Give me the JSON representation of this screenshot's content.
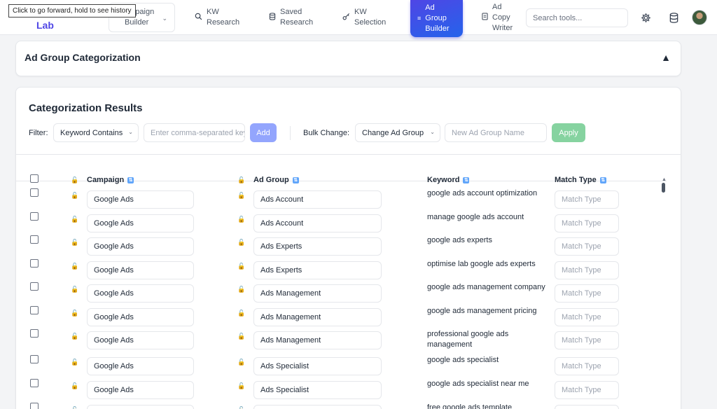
{
  "app": {
    "brand_fragment": "Lab",
    "tooltip": "Click to go forward, hold to see history"
  },
  "nav": {
    "campaign_builder": [
      "ampaign",
      "Builder"
    ],
    "kw_research": [
      "KW",
      "Research"
    ],
    "saved_research": [
      "Saved",
      "Research"
    ],
    "kw_selection": [
      "KW",
      "Selection"
    ],
    "ad_group_builder": [
      "Ad",
      "Group",
      "Builder"
    ],
    "ad_copy_writer": [
      "Ad",
      "Copy",
      "Writer"
    ],
    "search_placeholder": "Search tools...",
    "active_item": "ad_group_builder",
    "active_gradient": [
      "#4f46e5",
      "#2563eb"
    ]
  },
  "section": {
    "title": "Ad Group Categorization",
    "collapse_glyph": "▲"
  },
  "results": {
    "title": "Categorization Results",
    "filter": {
      "label": "Filter:",
      "select_value": "Keyword Contains",
      "input_placeholder": "Enter comma-separated keywords",
      "add_label": "Add"
    },
    "bulk": {
      "label": "Bulk Change:",
      "select_value": "Change Ad Group",
      "name_placeholder": "New Ad Group Name",
      "apply_label": "Apply"
    },
    "columns": {
      "campaign": "Campaign",
      "ad_group": "Ad Group",
      "keyword": "Keyword",
      "match_type": "Match Type"
    },
    "match_type_placeholder": "Match Type",
    "rows": [
      {
        "campaign": "Google Ads",
        "ad_group": "Ads Account",
        "keyword": "google ads account optimization"
      },
      {
        "campaign": "Google Ads",
        "ad_group": "Ads Account",
        "keyword": "manage google ads account"
      },
      {
        "campaign": "Google Ads",
        "ad_group": "Ads Experts",
        "keyword": "google ads experts"
      },
      {
        "campaign": "Google Ads",
        "ad_group": "Ads Experts",
        "keyword": "optimise lab google ads experts"
      },
      {
        "campaign": "Google Ads",
        "ad_group": "Ads Management",
        "keyword": "google ads management company"
      },
      {
        "campaign": "Google Ads",
        "ad_group": "Ads Management",
        "keyword": "google ads management pricing"
      },
      {
        "campaign": "Google Ads",
        "ad_group": "Ads Management",
        "keyword": "professional google ads management"
      },
      {
        "campaign": "Google Ads",
        "ad_group": "Ads Specialist",
        "keyword": "google ads specialist"
      },
      {
        "campaign": "Google Ads",
        "ad_group": "Ads Specialist",
        "keyword": "google ads specialist near me"
      },
      {
        "campaign": "",
        "ad_group": "",
        "keyword": "free google ads template"
      }
    ],
    "colors": {
      "add_button": "#93a5fd",
      "apply_button": "#86d3a0",
      "sort_icon": "#60a5fa",
      "lock_icon": "#d97706"
    }
  }
}
